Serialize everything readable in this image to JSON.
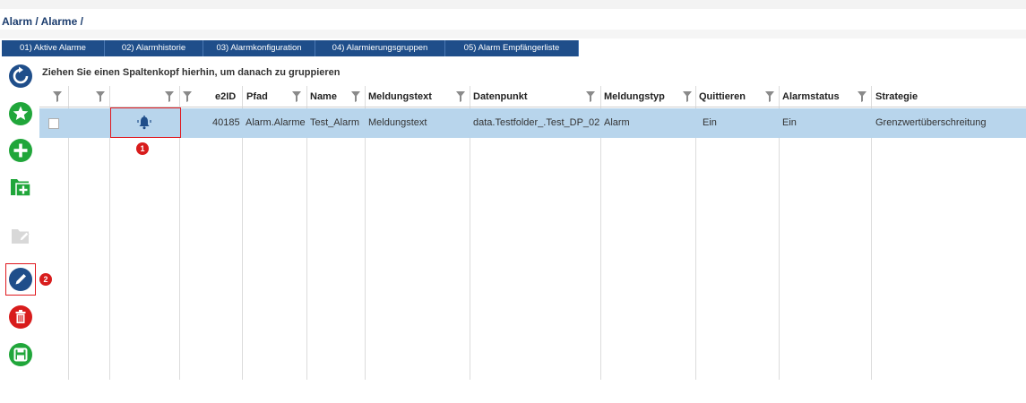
{
  "breadcrumb": "Alarm / Alarme /",
  "tabs": [
    {
      "label": "01) Aktive Alarme"
    },
    {
      "label": "02) Alarmhistorie"
    },
    {
      "label": "03) Alarmkonfiguration"
    },
    {
      "label": "04) Alarmierungsgruppen"
    },
    {
      "label": "05) Alarm Empfängerliste"
    }
  ],
  "toolbar": {
    "refresh": "refresh-icon",
    "favorite": "star-icon",
    "add": "plus-icon",
    "add_folder": "folder-plus-icon",
    "edit_folder": "folder-edit-icon",
    "edit": "pencil-icon",
    "delete": "trash-icon",
    "save": "save-icon"
  },
  "grid": {
    "group_hint": "Ziehen Sie einen Spaltenkopf hierhin, um danach zu gruppieren",
    "columns": {
      "e2id": "e2ID",
      "pfad": "Pfad",
      "name": "Name",
      "meldungstext": "Meldungstext",
      "datenpunkt": "Datenpunkt",
      "meldungstyp": "Meldungstyp",
      "quittieren": "Quittieren",
      "alarmstatus": "Alarmstatus",
      "strategie": "Strategie"
    },
    "row": {
      "e2id": "40185",
      "pfad": "Alarm.Alarme",
      "name": "Test_Alarm",
      "meldungstext": "Meldungstext",
      "datenpunkt": "data.Testfolder_.Test_DP_02",
      "meldungstyp": "Alarm",
      "quittieren": "Ein",
      "alarmstatus": "Ein",
      "strategie": "Grenzwertüberschreitung"
    }
  },
  "annotations": {
    "badge1": "1",
    "badge2": "2"
  },
  "colors": {
    "tab_bg": "#1f4e8a",
    "row_selected": "#b8d5ec",
    "highlight": "#e0181e"
  }
}
